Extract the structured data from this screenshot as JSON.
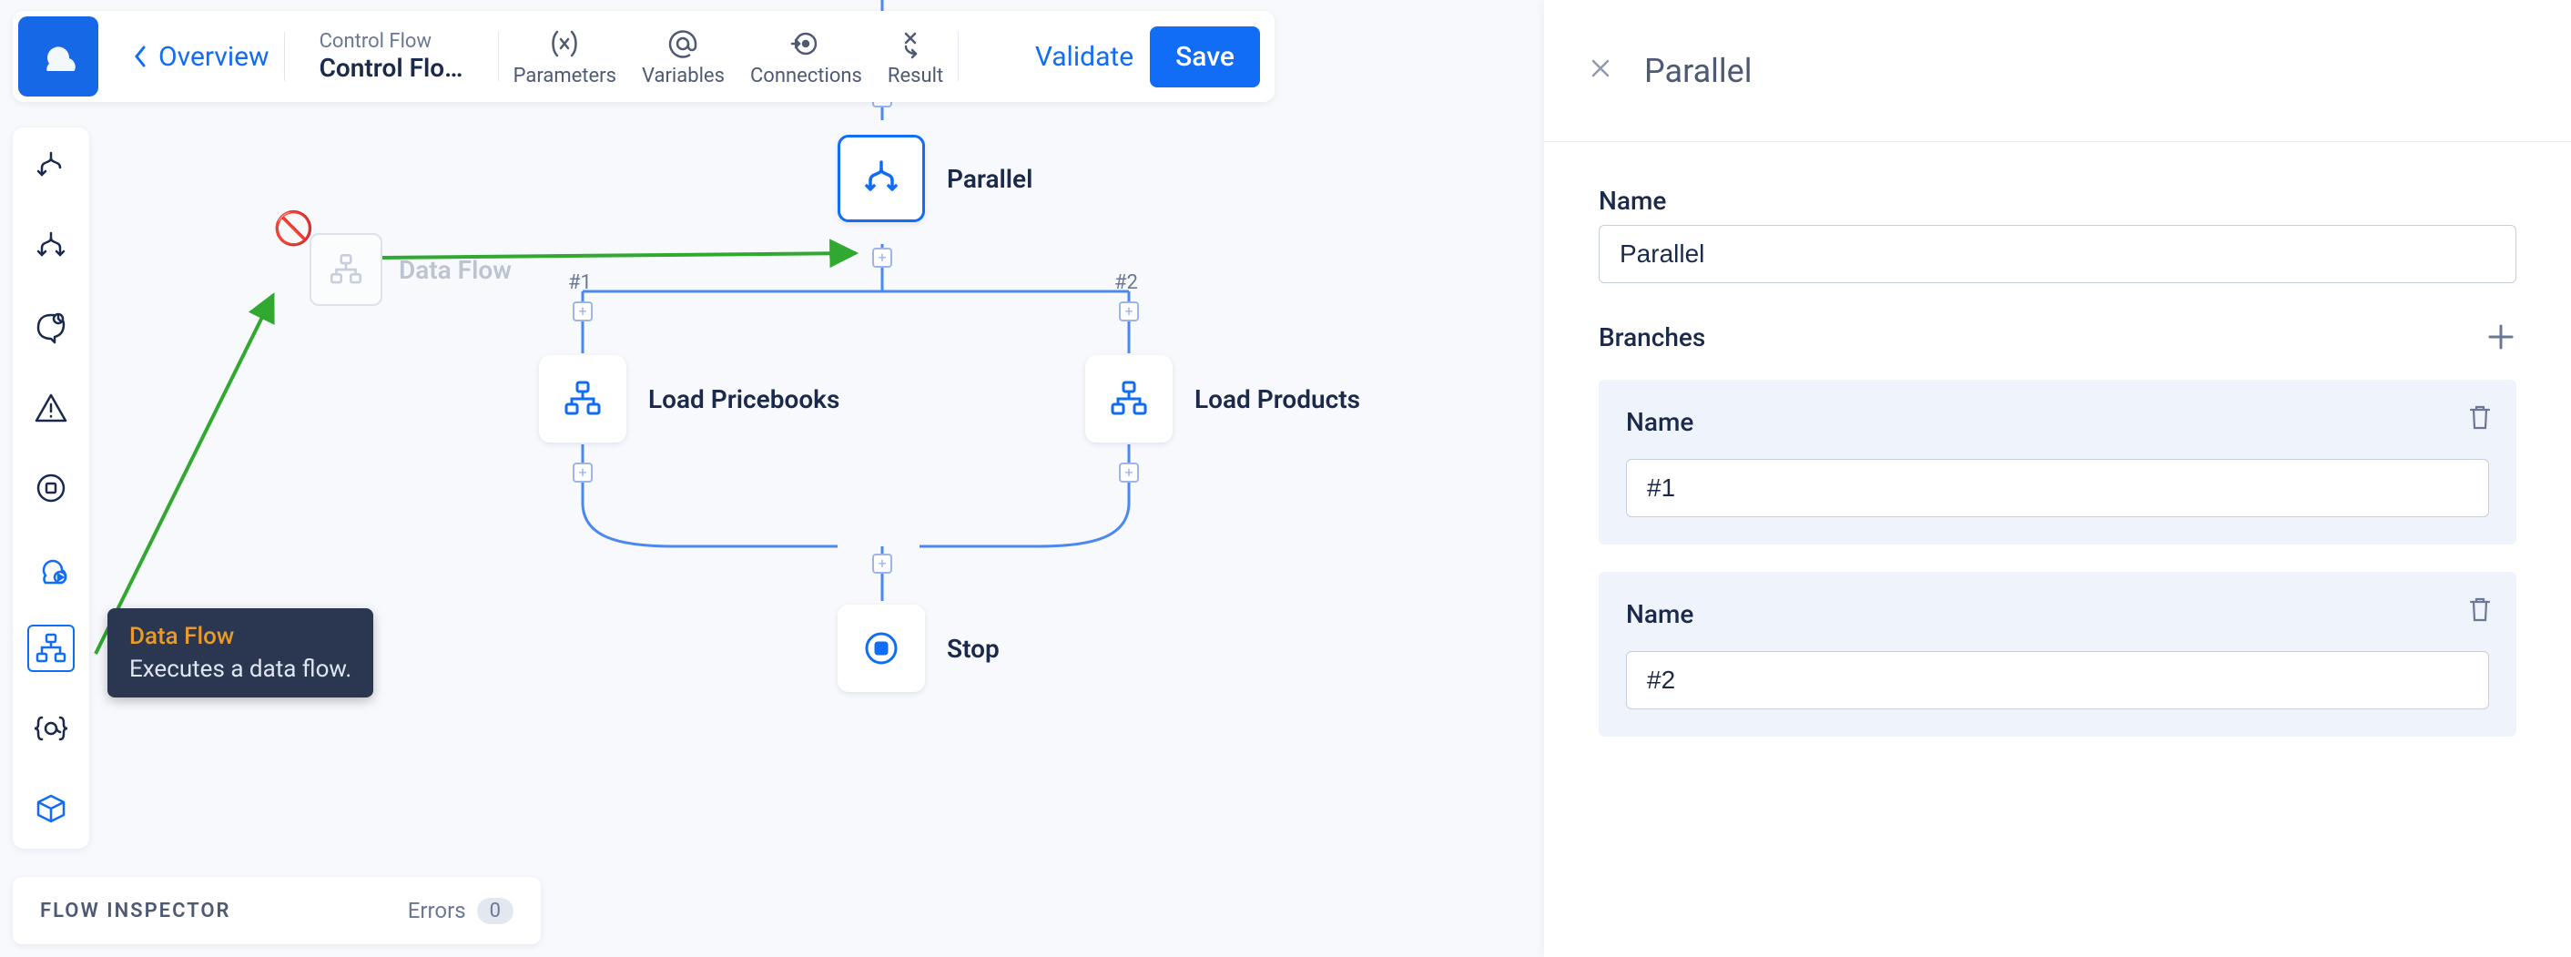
{
  "colors": {
    "primary": "#116df6",
    "accent_orange": "#e89a2b",
    "tooltip_bg": "#2b3750"
  },
  "topbar": {
    "back_label": "Overview",
    "breadcrumb_super": "Control Flow",
    "breadcrumb_main": "Control Flo…",
    "items": [
      {
        "icon": "parentheses-x-icon",
        "label": "Parameters"
      },
      {
        "icon": "at-icon",
        "label": "Variables"
      },
      {
        "icon": "target-arrow-icon",
        "label": "Connections"
      },
      {
        "icon": "x-arrow-icon",
        "label": "Result"
      }
    ],
    "validate_label": "Validate",
    "save_label": "Save"
  },
  "palette": {
    "items": [
      {
        "name": "step-icon"
      },
      {
        "name": "parallel-icon"
      },
      {
        "name": "condition-icon"
      },
      {
        "name": "error-icon"
      },
      {
        "name": "stop-circle-icon"
      },
      {
        "name": "cloud-play-icon"
      },
      {
        "name": "data-flow-icon"
      },
      {
        "name": "variable-ref-icon"
      },
      {
        "name": "box-3d-icon"
      }
    ],
    "selected_index": 6
  },
  "tooltip": {
    "title": "Data Flow",
    "subtitle": "Executes a data flow."
  },
  "canvas": {
    "drag_ghost_label": "Data Flow",
    "nodes": {
      "parallel": {
        "label": "Parallel",
        "selected": true
      },
      "load_pricebooks": {
        "label": "Load Pricebooks"
      },
      "load_products": {
        "label": "Load Products"
      },
      "stop": {
        "label": "Stop"
      }
    },
    "branches": [
      {
        "index_label": "#1"
      },
      {
        "index_label": "#2"
      }
    ]
  },
  "inspector": {
    "title": "FLOW INSPECTOR",
    "errors_label": "Errors",
    "errors_count": "0"
  },
  "right_panel": {
    "title": "Parallel",
    "name_field_label": "Name",
    "name_value": "Parallel",
    "branches_label": "Branches",
    "branch_name_label": "Name",
    "branches": [
      {
        "name": "#1"
      },
      {
        "name": "#2"
      }
    ]
  }
}
